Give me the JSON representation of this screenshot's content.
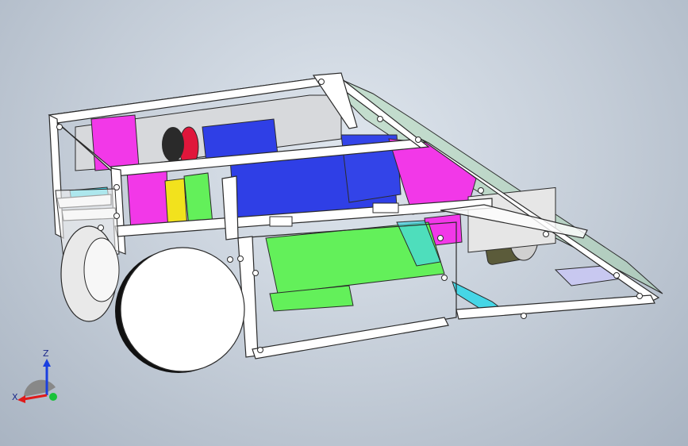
{
  "viewport": {
    "background": [
      "#dfe6ee",
      "#a9b4c2"
    ]
  },
  "triad": {
    "z_label": "Z",
    "x_label": "X",
    "colors": {
      "z": "#1a3fe0",
      "x": "#e01a1a",
      "y": "#19c23a"
    }
  },
  "model": {
    "colors": {
      "frame": "#ffffff",
      "edge": "#2b2b2b",
      "magenta": "#f238e8",
      "blue": "#2f3fe6",
      "green": "#63f05a",
      "yellow": "#f2e21d",
      "cyan": "#46d6e6",
      "red": "#e0163b",
      "grey": "#c9c9c9",
      "glass": "#9bd79b"
    }
  }
}
